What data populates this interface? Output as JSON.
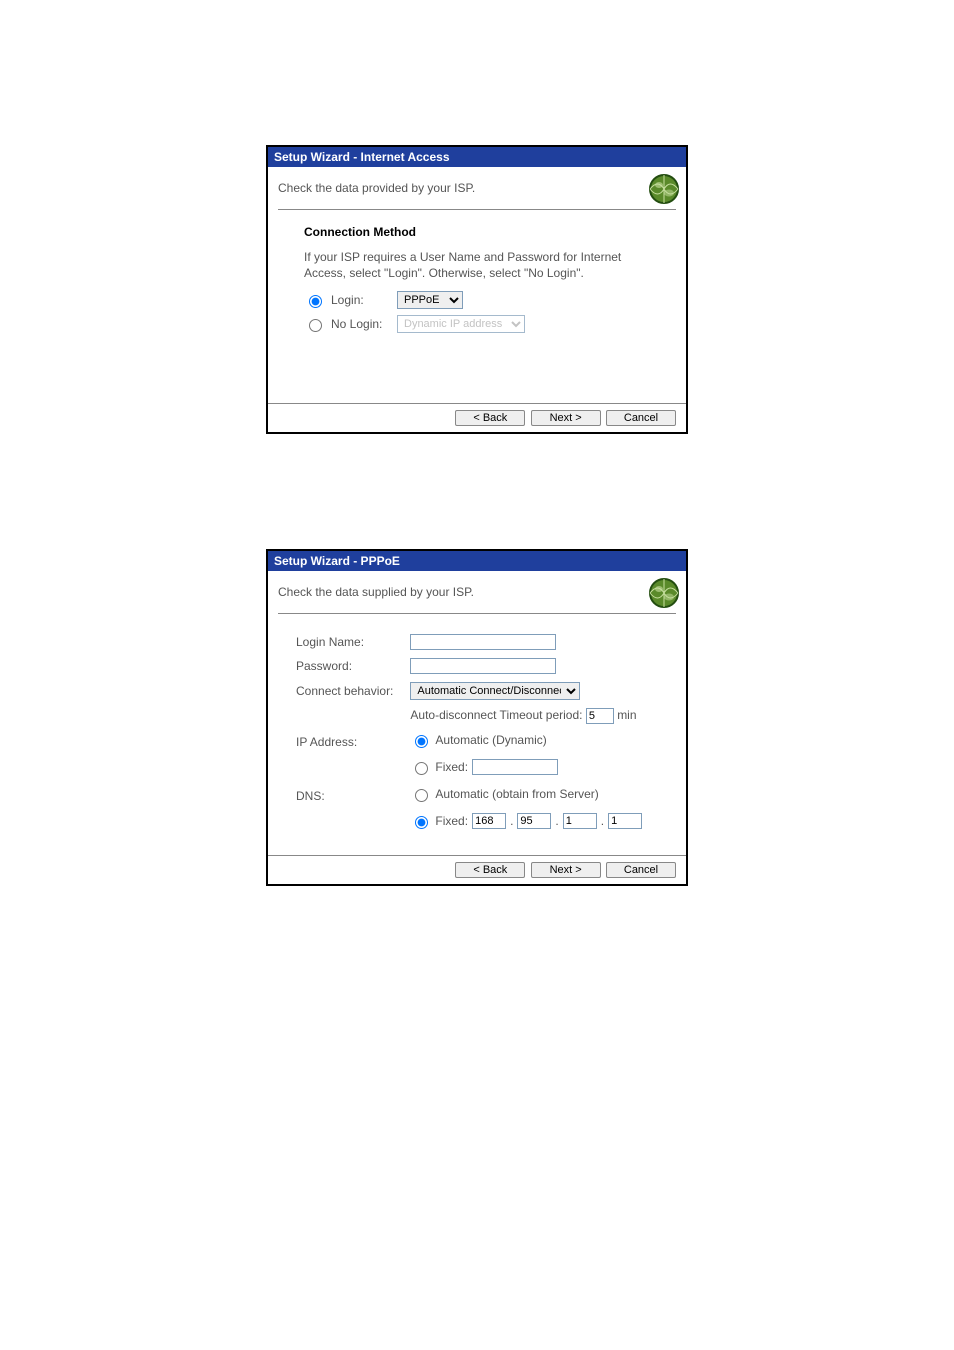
{
  "dialog1": {
    "title": "Setup Wizard - Internet Access",
    "header": "Check the data provided by your ISP.",
    "section_title": "Connection Method",
    "helper": "If your ISP requires a User Name and Password for Internet Access, select \"Login\". Otherwise, select \"No Login\".",
    "login_label": "Login:",
    "nologin_label": "No Login:",
    "login_sel": "PPPoE",
    "nologin_sel": "Dynamic IP address",
    "back": "< Back",
    "next": "Next >",
    "cancel": "Cancel"
  },
  "dialog2": {
    "title": "Setup Wizard - PPPoE",
    "header": "Check the data supplied by your ISP.",
    "labels": {
      "login_name": "Login Name:",
      "password": "Password:",
      "connect_behavior": "Connect behavior:",
      "timeout_prefix": "Auto-disconnect Timeout period:",
      "timeout_suffix": "min",
      "ip_address": "IP Address:",
      "dns": "DNS:"
    },
    "fields": {
      "login_name": "",
      "password": "",
      "connect_behavior": "Automatic Connect/Disconnect",
      "timeout": "5",
      "ip_auto_label": "Automatic (Dynamic)",
      "ip_fixed_label": "Fixed:",
      "ip_fixed_value": "",
      "dns_auto_label": "Automatic (obtain from Server)",
      "dns_fixed_label": "Fixed:",
      "dns_octets": [
        "168",
        "95",
        "1",
        "1"
      ]
    },
    "back": "< Back",
    "next": "Next >",
    "cancel": "Cancel"
  }
}
